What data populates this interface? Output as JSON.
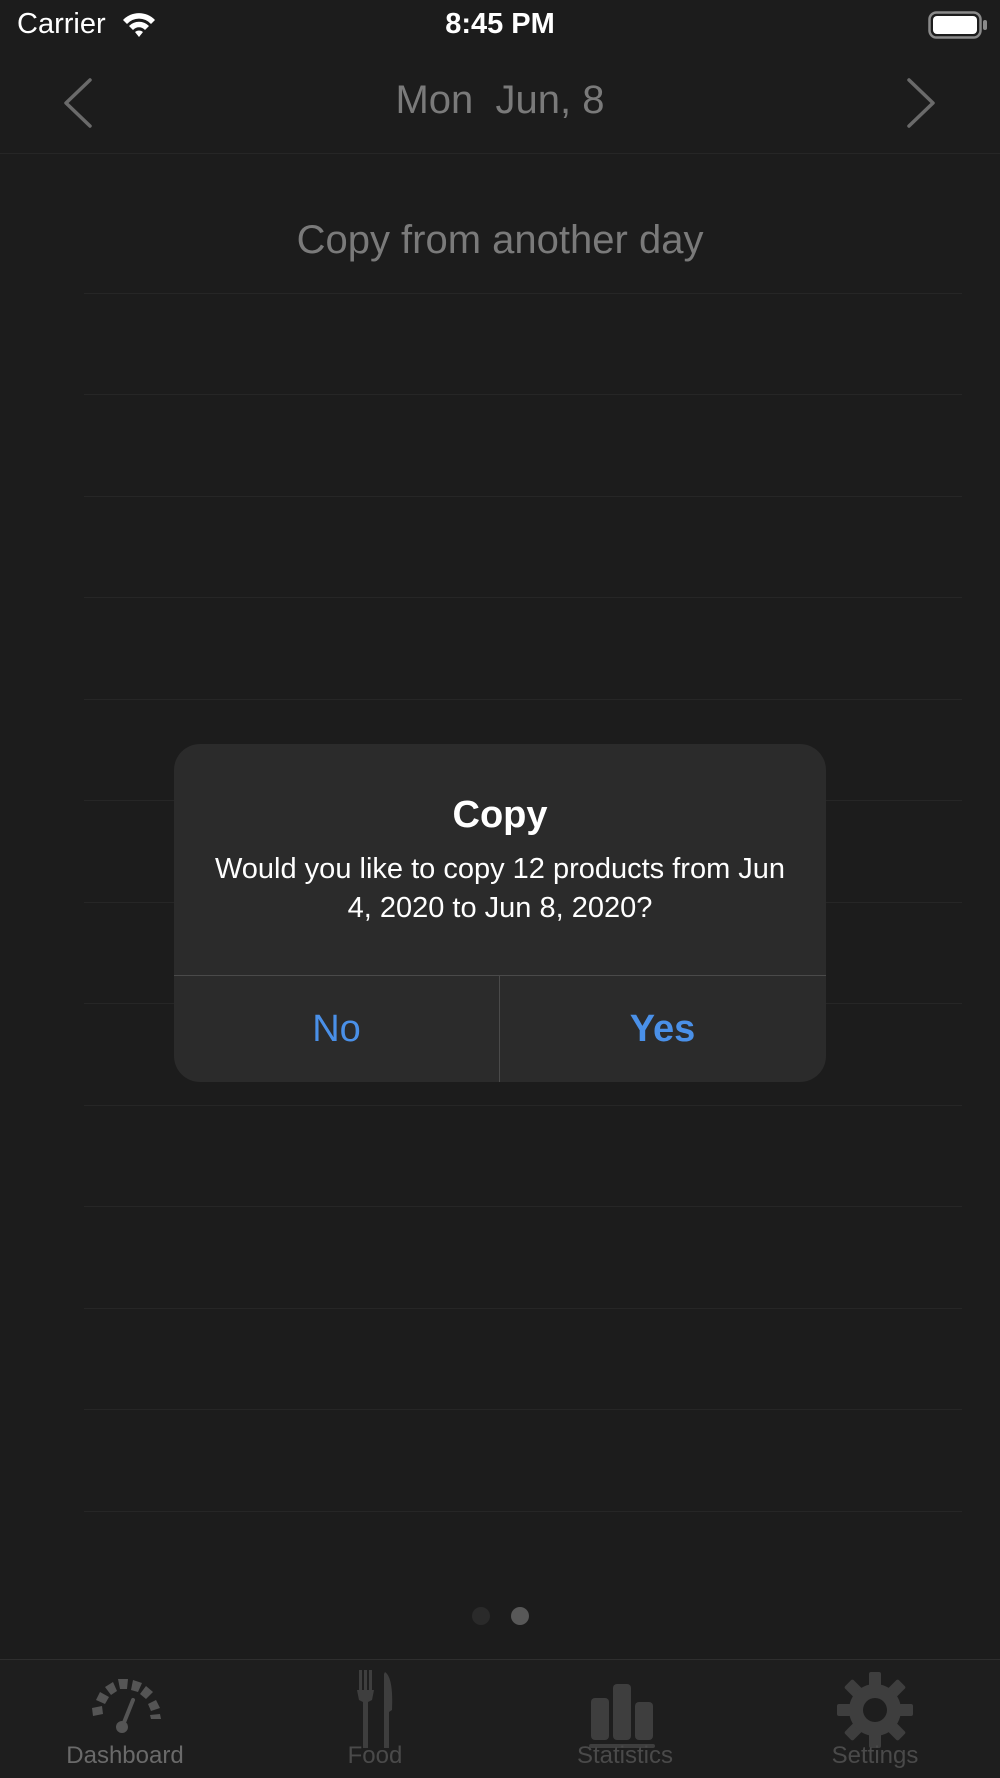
{
  "status_bar": {
    "carrier": "Carrier",
    "time": "8:45 PM",
    "wifi_icon": "wifi-icon",
    "battery_icon": "battery-icon"
  },
  "date_nav": {
    "title": "Mon  Jun, 8",
    "prev_icon": "chevron-left-icon",
    "next_icon": "chevron-right-icon"
  },
  "main": {
    "header": "Copy from another day"
  },
  "page_control": {
    "count": 2,
    "current": 2
  },
  "alert": {
    "title": "Copy",
    "message": "Would you like to copy 12 products from Jun 4, 2020 to Jun 8, 2020?",
    "no_label": "No",
    "yes_label": "Yes",
    "button_color": "#4a90e8"
  },
  "tab_bar": {
    "tabs": [
      {
        "label": "Dashboard",
        "icon": "speedometer-icon",
        "active": true
      },
      {
        "label": "Food",
        "icon": "fork-knife-icon",
        "active": false
      },
      {
        "label": "Statistics",
        "icon": "bar-chart-icon",
        "active": false
      },
      {
        "label": "Settings",
        "icon": "gear-icon",
        "active": false
      }
    ]
  },
  "colors": {
    "background": "#1c1c1c",
    "alert_background": "#2b2b2b",
    "accent": "#4a90e8",
    "muted_text": "#7a7a7a"
  }
}
